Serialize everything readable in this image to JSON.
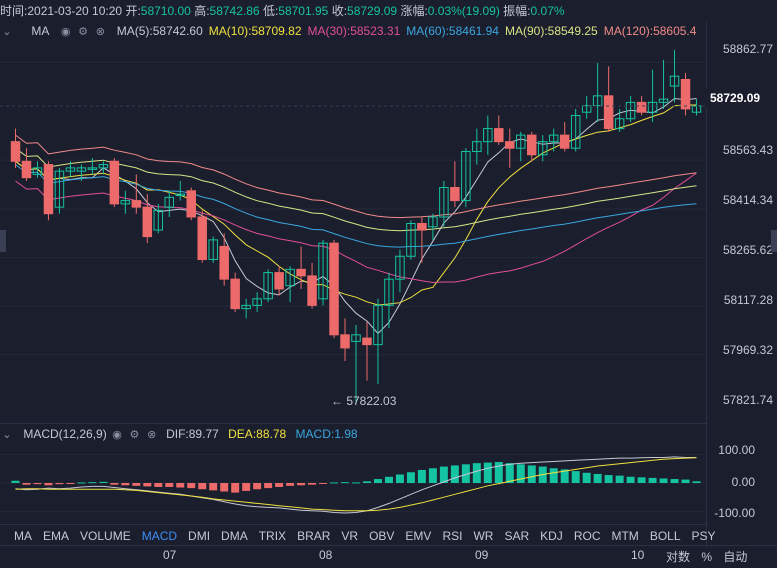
{
  "info": {
    "time_label": "时间:",
    "time_value": "2021-03-20 10:20",
    "open_label": "开:",
    "open_value": "58710.00",
    "high_label": "高:",
    "high_value": "58742.86",
    "low_label": "低:",
    "low_value": "58701.95",
    "close_label": "收:",
    "close_value": "58729.09",
    "change_label": "涨幅:",
    "change_value": "0.03%(19.09)",
    "amplitude_label": "振幅:",
    "amplitude_value": "0.07%"
  },
  "ma_legend": {
    "name": "MA",
    "items": [
      {
        "label": "MA(5):58742.60",
        "color": "#c6c9d4"
      },
      {
        "label": "MA(10):58709.82",
        "color": "#f0e040"
      },
      {
        "label": "MA(30):58523.31",
        "color": "#e04f9a"
      },
      {
        "label": "MA(60):58461.94",
        "color": "#3aa7e0"
      },
      {
        "label": "MA(90):58549.25",
        "color": "#d8e488"
      },
      {
        "label": "MA(120):58605.4",
        "color": "#f08a8a"
      }
    ]
  },
  "price_axis": {
    "labels": [
      "58862.77",
      "58563.43",
      "58414.34",
      "58265.62",
      "58117.28",
      "57969.32",
      "57821.74"
    ],
    "current": "58729.09"
  },
  "low_marker": "← 57822.03",
  "macd_legend": {
    "name": "MACD(12,26,9)",
    "dif": "DIF:89.77",
    "dea": "DEA:88.78",
    "macd": "MACD:1.98"
  },
  "macd_axis": [
    "100.00",
    "0.00",
    "-100.00"
  ],
  "tabs": [
    "MA",
    "EMA",
    "VOLUME",
    "MACD",
    "DMI",
    "DMA",
    "TRIX",
    "BRAR",
    "VR",
    "OBV",
    "EMV",
    "RSI",
    "WR",
    "SAR",
    "KDJ",
    "ROC",
    "MTM",
    "BOLL",
    "PSY"
  ],
  "active_tab": "MACD",
  "dates": [
    "07",
    "08",
    "09",
    "10"
  ],
  "footer": {
    "log": "对数",
    "pct": "%",
    "auto": "自动"
  },
  "colors": {
    "up": "#14c3a2",
    "down": "#ec6a6a",
    "background": "#1b1e2c"
  },
  "chart_data": {
    "type": "candlestick",
    "ylim": [
      57821.74,
      58900
    ],
    "candles": [
      [
        58620,
        58660,
        58540,
        58560
      ],
      [
        58560,
        58600,
        58500,
        58510
      ],
      [
        58520,
        58560,
        58510,
        58540
      ],
      [
        58550,
        58560,
        58380,
        58400
      ],
      [
        58420,
        58540,
        58400,
        58530
      ],
      [
        58530,
        58560,
        58510,
        58540
      ],
      [
        58530,
        58550,
        58500,
        58540
      ],
      [
        58540,
        58570,
        58520,
        58540
      ],
      [
        58540,
        58560,
        58520,
        58550
      ],
      [
        58560,
        58570,
        58420,
        58430
      ],
      [
        58430,
        58470,
        58400,
        58440
      ],
      [
        58440,
        58520,
        58400,
        58420
      ],
      [
        58420,
        58460,
        58310,
        58330
      ],
      [
        58350,
        58430,
        58340,
        58410
      ],
      [
        58420,
        58470,
        58390,
        58450
      ],
      [
        58460,
        58500,
        58440,
        58460
      ],
      [
        58470,
        58480,
        58380,
        58390
      ],
      [
        58390,
        58410,
        58250,
        58260
      ],
      [
        58260,
        58330,
        58250,
        58320
      ],
      [
        58300,
        58340,
        58180,
        58200
      ],
      [
        58200,
        58220,
        58100,
        58110
      ],
      [
        58110,
        58140,
        58080,
        58120
      ],
      [
        58120,
        58160,
        58100,
        58140
      ],
      [
        58140,
        58230,
        58130,
        58220
      ],
      [
        58220,
        58240,
        58150,
        58170
      ],
      [
        58180,
        58240,
        58130,
        58230
      ],
      [
        58230,
        58300,
        58170,
        58210
      ],
      [
        58210,
        58250,
        58110,
        58120
      ],
      [
        58140,
        58320,
        58120,
        58310
      ],
      [
        58310,
        58320,
        58020,
        58030
      ],
      [
        58030,
        58080,
        57950,
        57990
      ],
      [
        58010,
        58060,
        57822,
        58030
      ],
      [
        58020,
        58070,
        57890,
        58000
      ],
      [
        58000,
        58140,
        57880,
        58120
      ],
      [
        58120,
        58220,
        58050,
        58200
      ],
      [
        58200,
        58290,
        58160,
        58270
      ],
      [
        58270,
        58380,
        58260,
        58370
      ],
      [
        58370,
        58390,
        58250,
        58350
      ],
      [
        58360,
        58400,
        58320,
        58390
      ],
      [
        58390,
        58500,
        58360,
        58480
      ],
      [
        58480,
        58560,
        58420,
        58440
      ],
      [
        58440,
        58600,
        58420,
        58590
      ],
      [
        58590,
        58660,
        58550,
        58620
      ],
      [
        58620,
        58700,
        58580,
        58660
      ],
      [
        58660,
        58700,
        58610,
        58620
      ],
      [
        58620,
        58660,
        58540,
        58600
      ],
      [
        58600,
        58650,
        58560,
        58640
      ],
      [
        58640,
        58650,
        58560,
        58580
      ],
      [
        58580,
        58640,
        58560,
        58620
      ],
      [
        58620,
        58660,
        58590,
        58640
      ],
      [
        58640,
        58680,
        58590,
        58600
      ],
      [
        58600,
        58720,
        58590,
        58700
      ],
      [
        58710,
        58760,
        58690,
        58730
      ],
      [
        58730,
        58860,
        58680,
        58760
      ],
      [
        58760,
        58850,
        58650,
        58660
      ],
      [
        58660,
        58720,
        58650,
        58690
      ],
      [
        58690,
        58760,
        58680,
        58740
      ],
      [
        58740,
        58760,
        58700,
        58710
      ],
      [
        58710,
        58840,
        58680,
        58740
      ],
      [
        58740,
        58870,
        58720,
        58750
      ],
      [
        58790,
        58900,
        58740,
        58820
      ],
      [
        58810,
        58830,
        58700,
        58720
      ],
      [
        58710,
        58750,
        58700,
        58729
      ]
    ],
    "macd_ylim": [
      -120,
      120
    ],
    "macd_hist": [
      8,
      -6,
      -4,
      -8,
      -4,
      -3,
      2,
      3,
      4,
      -6,
      -8,
      -10,
      -12,
      -14,
      -14,
      -16,
      -18,
      -22,
      -26,
      -30,
      -34,
      -28,
      -22,
      -18,
      -14,
      -10,
      -8,
      -6,
      -2,
      2,
      3,
      2,
      6,
      14,
      22,
      30,
      38,
      46,
      52,
      58,
      62,
      66,
      70,
      72,
      74,
      70,
      66,
      62,
      58,
      52,
      48,
      42,
      36,
      32,
      28,
      26,
      22,
      20,
      18,
      16,
      14,
      12,
      6
    ],
    "dif": [
      -20,
      -24,
      -22,
      -18,
      -20,
      -18,
      -14,
      -12,
      -12,
      -16,
      -20,
      -24,
      -28,
      -32,
      -36,
      -40,
      -46,
      -52,
      -58,
      -66,
      -74,
      -80,
      -84,
      -86,
      -88,
      -92,
      -96,
      -98,
      -100,
      -104,
      -106,
      -104,
      -98,
      -86,
      -72,
      -56,
      -40,
      -24,
      -10,
      4,
      18,
      30,
      42,
      52,
      60,
      66,
      70,
      72,
      74,
      76,
      78,
      80,
      82,
      84,
      86,
      88,
      88,
      89,
      90,
      90,
      92,
      90,
      90
    ],
    "dea": [
      -22,
      -20,
      -20,
      -22,
      -22,
      -22,
      -22,
      -22,
      -22,
      -22,
      -24,
      -26,
      -30,
      -34,
      -38,
      -42,
      -46,
      -50,
      -56,
      -60,
      -64,
      -68,
      -72,
      -76,
      -80,
      -84,
      -88,
      -92,
      -94,
      -96,
      -98,
      -98,
      -98,
      -96,
      -92,
      -86,
      -78,
      -70,
      -60,
      -50,
      -40,
      -30,
      -20,
      -10,
      -2,
      6,
      14,
      22,
      30,
      36,
      42,
      48,
      54,
      60,
      64,
      68,
      72,
      76,
      80,
      84,
      86,
      88,
      88.78
    ]
  }
}
